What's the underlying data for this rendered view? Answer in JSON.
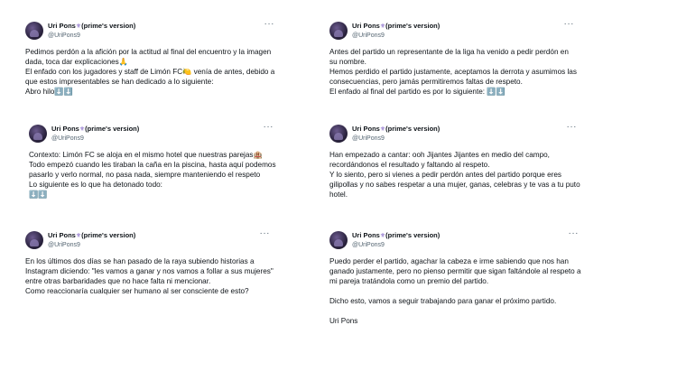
{
  "author": {
    "name": "Uri Pons",
    "badge_icon": "fleur-de-lis-icon",
    "version": "(prime's version)",
    "handle": "@UriPons9",
    "more_icon": "more-dots-icon"
  },
  "tweets": [
    {
      "lines": [
        "Pedimos perdón a la afición por la actitud al final del encuentro y la imagen dada, toca dar explicaciones🙏",
        "El enfado con los jugadores y staff de Limón FC🍋 venía de antes, debido a que estos impresentables se han dedicado a lo siguiente:",
        "Abro hilo⬇️⬇️"
      ]
    },
    {
      "lines": [
        "Antes del partido un representante de la liga ha venido a pedir perdón en su nombre.",
        "Hemos perdido el partido justamente, aceptamos la derrota y asumimos las consecuencias, pero jamás permitiremos faltas de respeto.",
        "El enfado al final del partido es por lo siguiente: ⬇️⬇️"
      ]
    },
    {
      "lines": [
        "Contexto: Limón FC se aloja en el mismo hotel que nuestras parejas🏨",
        "Todo empezó cuando les tiraban la caña en la piscina, hasta aquí podemos pasarlo y verlo normal, no pasa nada, siempre manteniendo el respeto",
        "Lo siguiente es lo que ha detonado todo:",
        "⬇️⬇️"
      ]
    },
    {
      "lines": [
        "Han empezado a cantar: ooh Jijantes Jijantes en medio del campo, recordándonos el resultado y faltando al respeto.",
        "Y lo siento, pero si vienes a pedir perdón antes del partido porque eres gilipollas y no sabes respetar a una mujer, ganas, celebras y te vas a tu puto hotel."
      ]
    },
    {
      "lines": [
        "En los últimos dos días se han pasado de la raya subiendo historias a Instagram diciendo: \"les vamos a ganar y nos vamos a follar a sus mujeres\" entre otras barbaridades que no hace falta ni mencionar.",
        "Como reaccionaría cualquier ser humano al ser consciente de esto?"
      ]
    },
    {
      "lines": [
        "Puedo perder el partido, agachar la cabeza e irme sabiendo que nos han ganado justamente, pero no pienso permitir que sigan faltándole al respeto a mi pareja tratándola como un premio del partido.",
        "Dicho esto, vamos a seguir trabajando para ganar el próximo partido.",
        "Uri Pons"
      ]
    }
  ]
}
